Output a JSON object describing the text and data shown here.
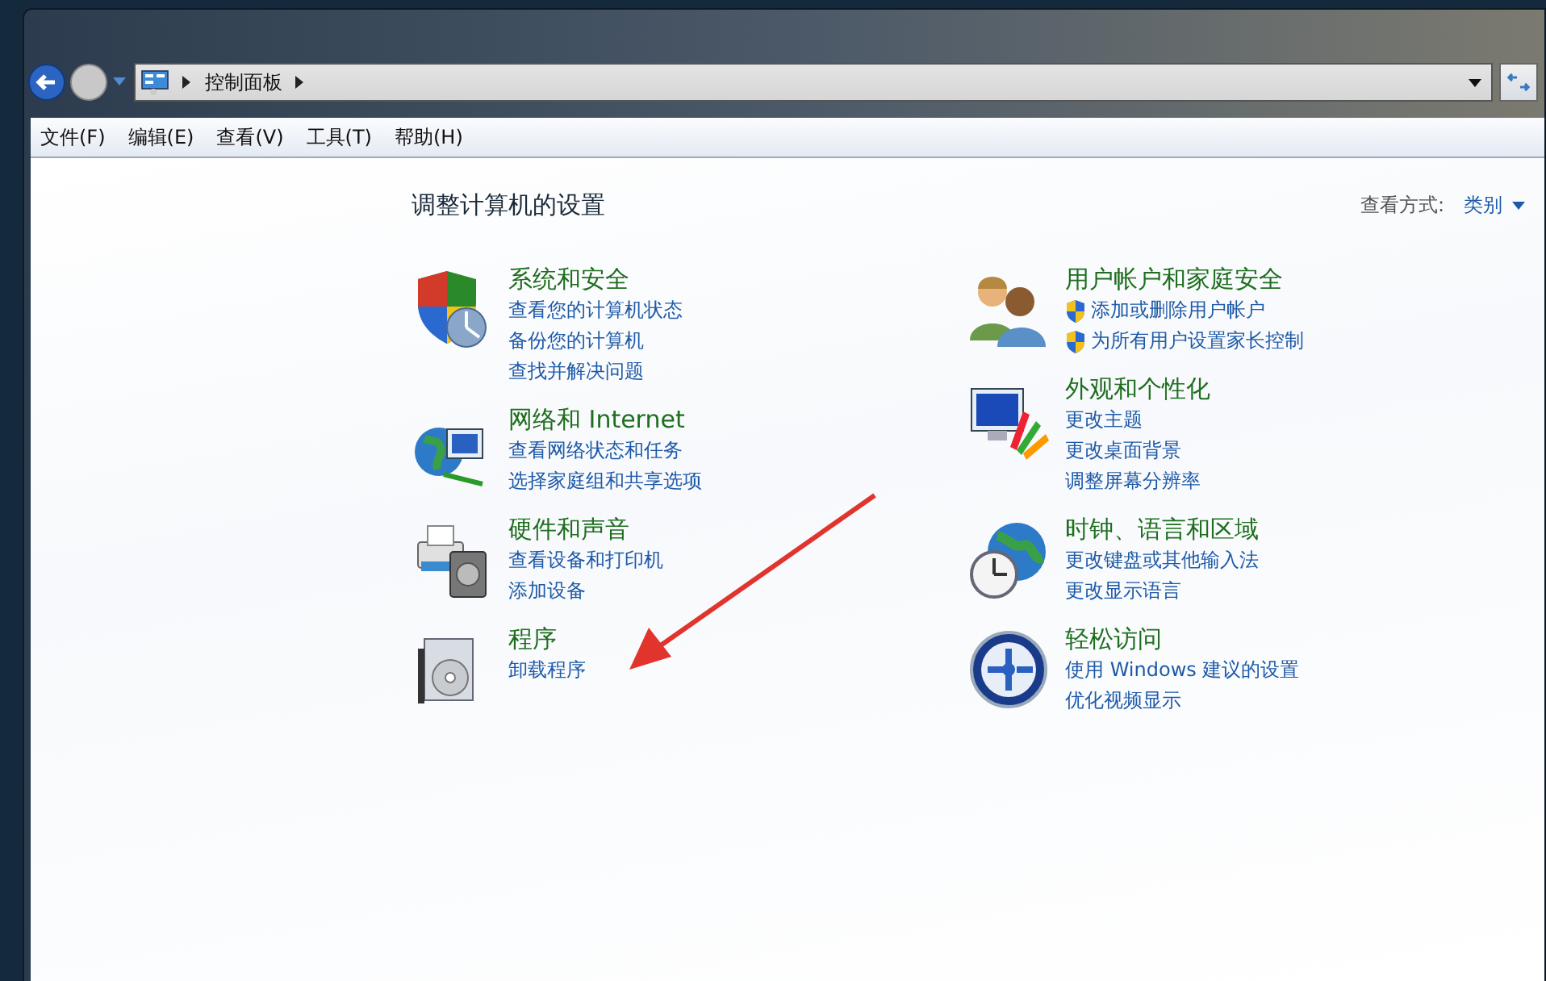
{
  "address_bar": {
    "crumbs": [
      "控制面板"
    ]
  },
  "menu_bar": [
    "文件(F)",
    "编辑(E)",
    "查看(V)",
    "工具(T)",
    "帮助(H)"
  ],
  "page_title": "调整计算机的设置",
  "view_by": {
    "label": "查看方式:",
    "value": "类别"
  },
  "columns": [
    [
      {
        "title": "系统和安全",
        "links": [
          {
            "text": "查看您的计算机状态",
            "shield": false
          },
          {
            "text": "备份您的计算机",
            "shield": false
          },
          {
            "text": "查找并解决问题",
            "shield": false
          }
        ]
      },
      {
        "title": "网络和 Internet",
        "links": [
          {
            "text": "查看网络状态和任务",
            "shield": false
          },
          {
            "text": "选择家庭组和共享选项",
            "shield": false
          }
        ]
      },
      {
        "title": "硬件和声音",
        "links": [
          {
            "text": "查看设备和打印机",
            "shield": false
          },
          {
            "text": "添加设备",
            "shield": false
          }
        ]
      },
      {
        "title": "程序",
        "links": [
          {
            "text": "卸载程序",
            "shield": false
          }
        ]
      }
    ],
    [
      {
        "title": "用户帐户和家庭安全",
        "links": [
          {
            "text": "添加或删除用户帐户",
            "shield": true
          },
          {
            "text": "为所有用户设置家长控制",
            "shield": true
          }
        ]
      },
      {
        "title": "外观和个性化",
        "links": [
          {
            "text": "更改主题",
            "shield": false
          },
          {
            "text": "更改桌面背景",
            "shield": false
          },
          {
            "text": "调整屏幕分辨率",
            "shield": false
          }
        ]
      },
      {
        "title": "时钟、语言和区域",
        "links": [
          {
            "text": "更改键盘或其他输入法",
            "shield": false
          },
          {
            "text": "更改显示语言",
            "shield": false
          }
        ]
      },
      {
        "title": "轻松访问",
        "links": [
          {
            "text": "使用 Windows 建议的设置",
            "shield": false
          },
          {
            "text": "优化视频显示",
            "shield": false
          }
        ]
      }
    ]
  ]
}
